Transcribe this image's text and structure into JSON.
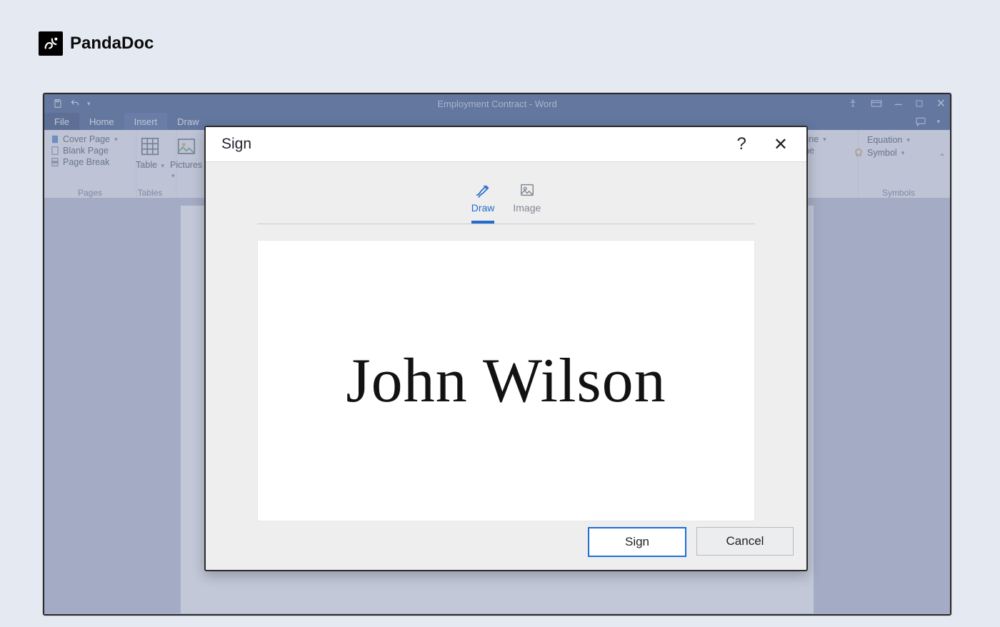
{
  "brand": {
    "name": "PandaDoc",
    "mark": "pd"
  },
  "window": {
    "title": "Employment Contract - Word",
    "menus": {
      "file": "File",
      "home": "Home",
      "insert": "Insert",
      "draw": "Draw"
    },
    "ribbon": {
      "pages": {
        "cover_page": "Cover Page",
        "blank_page": "Blank Page",
        "page_break": "Page Break",
        "group": "Pages"
      },
      "tables": {
        "table": "Table",
        "group": "Tables"
      },
      "illustrations": {
        "pictures": "Pictures"
      },
      "text": {
        "sig_line": "ure Line",
        "date_time": "& Time"
      },
      "symbols": {
        "equation": "Equation",
        "symbol": "Symbol",
        "group": "Symbols"
      }
    }
  },
  "dialog": {
    "title": "Sign",
    "tabs": {
      "draw": "Draw",
      "image": "Image"
    },
    "signature": "John Wilson",
    "buttons": {
      "sign": "Sign",
      "cancel": "Cancel"
    }
  }
}
